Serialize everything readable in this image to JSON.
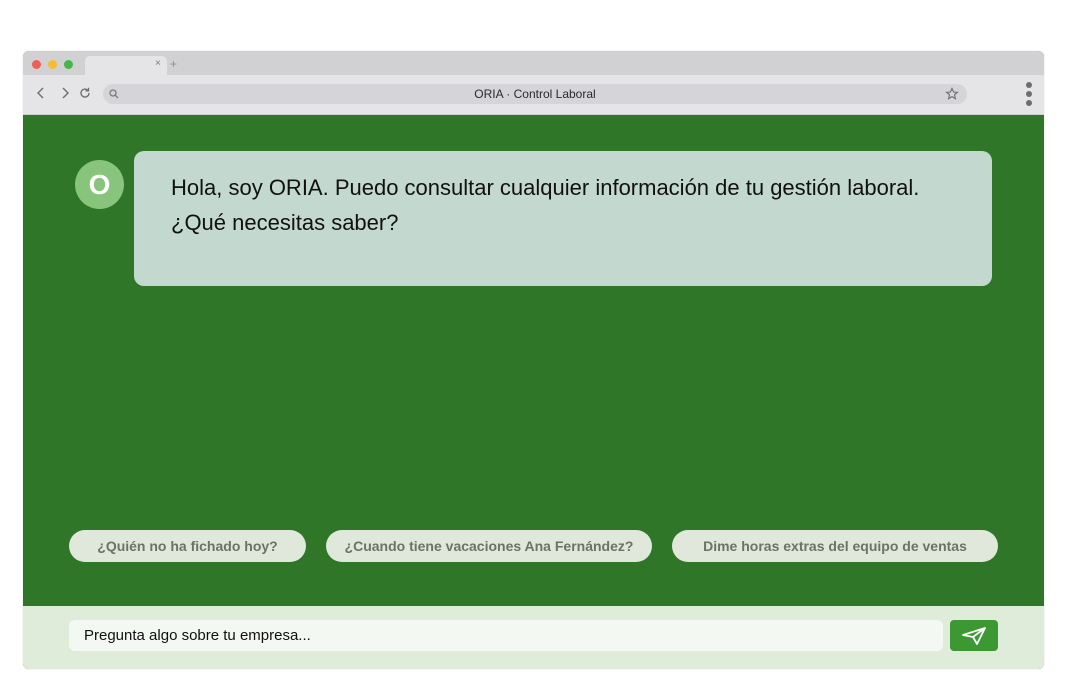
{
  "browser": {
    "url_title": "ORIA · Control Laboral",
    "tab_close": "×",
    "tab_new": "+"
  },
  "assistant": {
    "avatar_letter": "O",
    "greeting": "Hola, soy ORIA. Puedo consultar cualquier información de tu gestión laboral. ¿Qué necesitas saber?"
  },
  "suggestions": [
    "¿Quién no ha fichado hoy?",
    "¿Cuando tiene vacaciones Ana Fernández?",
    "Dime horas extras del equipo de ventas"
  ],
  "composer": {
    "placeholder": "Pregunta algo sobre tu empresa...",
    "send_icon": "paper-plane-icon"
  },
  "colors": {
    "chat_background": "#307628",
    "bubble": "#c3d9d0",
    "avatar": "#89c47d",
    "chip": "#dfe8db",
    "footer": "#dfecd9",
    "send_button": "#3c9832"
  }
}
